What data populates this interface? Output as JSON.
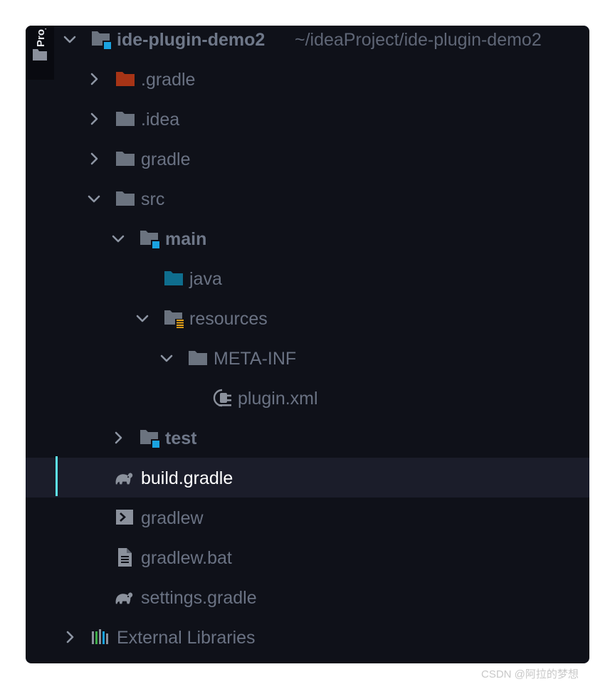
{
  "side_tab": {
    "label": "Project"
  },
  "project_root": {
    "name": "ide-plugin-demo2",
    "path": "~/ideaProject/ide-plugin-demo2"
  },
  "tree": [
    {
      "name": ".gradle"
    },
    {
      "name": ".idea"
    },
    {
      "name": "gradle"
    },
    {
      "name": "src"
    },
    {
      "name": "main"
    },
    {
      "name": "java"
    },
    {
      "name": "resources"
    },
    {
      "name": "META-INF"
    },
    {
      "name": "plugin.xml"
    },
    {
      "name": "test"
    },
    {
      "name": "build.gradle"
    },
    {
      "name": "gradlew"
    },
    {
      "name": "gradlew.bat"
    },
    {
      "name": "settings.gradle"
    }
  ],
  "external_libraries": {
    "name": "External Libraries"
  },
  "icons": {
    "folder": "folder-icon",
    "excluded_folder": "excluded-folder-icon",
    "module_folder": "module-folder-icon",
    "source_root": "source-root-icon",
    "resources_root": "resources-root-icon",
    "plugin_xml": "plugin-xml-icon",
    "gradle": "gradle-elephant-icon",
    "shell": "shell-script-icon",
    "text_file": "text-file-icon",
    "libraries": "libraries-icon"
  },
  "colors": {
    "background": "#0f1119",
    "text": "#6a7283",
    "selected_text": "#ffffff",
    "selection_accent": "#5ee7f0",
    "module_badge": "#1aa3e0",
    "excluded_folder": "#a73416",
    "source_folder": "#0f6e8e",
    "resources_badge": "#e8a317"
  },
  "watermark": "CSDN @阿拉的梦想"
}
